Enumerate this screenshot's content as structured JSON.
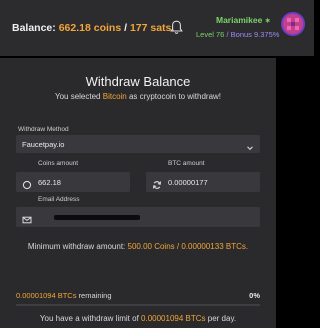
{
  "header": {
    "balance_label": "Balance:",
    "coins": "662.18 coins",
    "separator": "/",
    "sats": "177 sats.",
    "user": {
      "name": "Mariamikee",
      "level": "Level 76",
      "separator": "/",
      "bonus": "Bonus 9.375%"
    },
    "icons": [
      "bell-icon",
      "star-icon",
      "avatar"
    ]
  },
  "withdraw": {
    "title": "Withdraw Balance",
    "subtitle_prefix": "You selected",
    "coin": "Bitcoin",
    "subtitle_suffix": "as cryptocoin to withdraw!",
    "method_label": "Withdraw Method",
    "method_value": "Faucetpay.io",
    "coins_amount_label": "Coins amount",
    "coins_amount_value": "662.18",
    "btc_amount_label": "BTC amount",
    "btc_amount_value": "0.00000177",
    "email_label": "Email Address",
    "min_prefix": "Minimum withdraw amount:",
    "min_coins": "500.00 Coins",
    "min_separator": "/",
    "min_btc": "0.00000133 BTCs.",
    "remaining_value": "0.00001094 BTCs",
    "remaining_suffix": "remaining",
    "percent": "0%",
    "progress_fraction": 0.0,
    "limit_prefix": "You have a withdraw limit of",
    "limit_value": "0.00001094 BTCs",
    "limit_suffix": "per day."
  },
  "colors": {
    "accent": "#f2a53a",
    "green": "#7cd36a",
    "purple": "#9b8cf2",
    "panel": "#2a2a2d",
    "field": "#39393d"
  }
}
